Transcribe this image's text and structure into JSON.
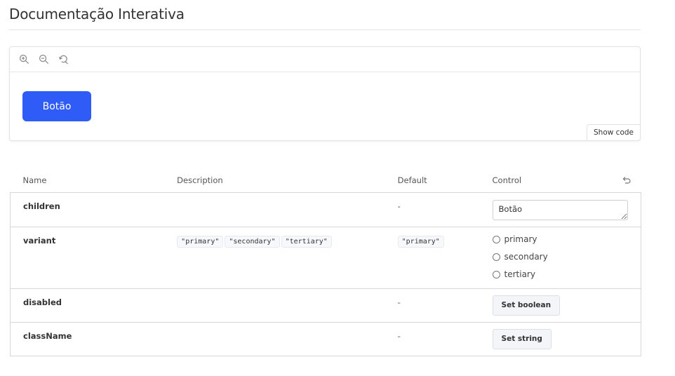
{
  "page": {
    "title": "Documentação Interativa"
  },
  "toolbar": {
    "icons": [
      "zoom-in-icon",
      "zoom-out-icon",
      "reset-zoom-icon"
    ]
  },
  "preview": {
    "button_label": "Botão",
    "show_code_label": "Show code",
    "accent_color": "#2f5cf6"
  },
  "table": {
    "headers": {
      "name": "Name",
      "description": "Description",
      "default": "Default",
      "control": "Control"
    },
    "rows": [
      {
        "name": "children",
        "description": [],
        "default": "-",
        "control": {
          "type": "text",
          "value": "Botão"
        }
      },
      {
        "name": "variant",
        "description": [
          "\"primary\"",
          "\"secondary\"",
          "\"tertiary\""
        ],
        "default": "\"primary\"",
        "control": {
          "type": "radio",
          "options": [
            "primary",
            "secondary",
            "tertiary"
          ]
        }
      },
      {
        "name": "disabled",
        "description": [],
        "default": "-",
        "control": {
          "type": "button",
          "label": "Set boolean"
        }
      },
      {
        "name": "className",
        "description": [],
        "default": "-",
        "control": {
          "type": "button",
          "label": "Set string"
        }
      }
    ]
  }
}
